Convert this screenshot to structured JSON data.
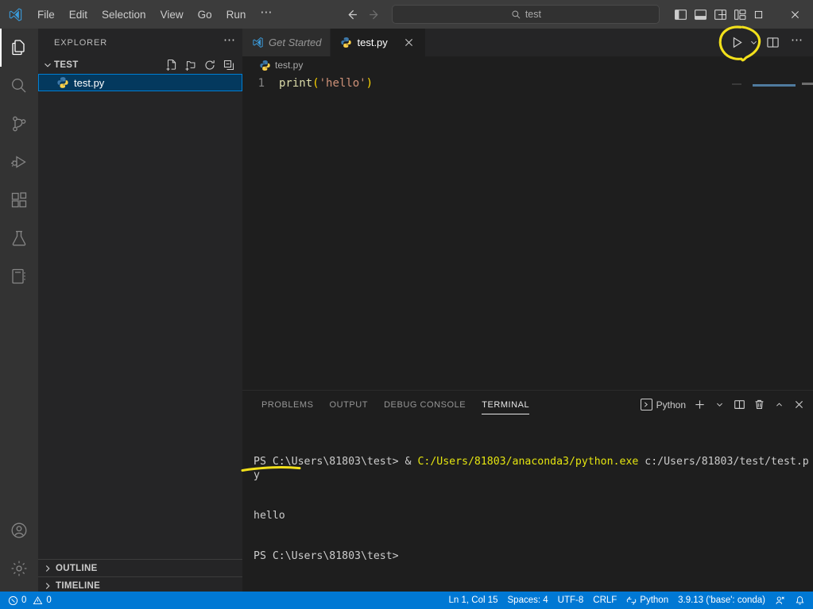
{
  "titlebar": {
    "logo_icon": "vscode-logo",
    "menus": [
      {
        "label": "File"
      },
      {
        "label": "Edit"
      },
      {
        "label": "Selection"
      },
      {
        "label": "View"
      },
      {
        "label": "Go"
      },
      {
        "label": "Run"
      },
      {
        "label": "⋯"
      }
    ],
    "nav": {
      "back_icon": "arrow-left-icon",
      "forward_icon": "arrow-right-icon"
    },
    "command_center": {
      "icon": "search-icon",
      "value": "test",
      "placeholder": "Search"
    },
    "layout_icons": [
      {
        "name": "toggle-primary-sidebar-icon"
      },
      {
        "name": "toggle-panel-icon"
      },
      {
        "name": "toggle-secondary-sidebar-icon"
      },
      {
        "name": "customize-layout-icon"
      }
    ],
    "window_controls": [
      {
        "name": "minimize-button",
        "glyph": "minimize"
      },
      {
        "name": "maximize-button",
        "glyph": "maximize"
      },
      {
        "name": "close-button",
        "glyph": "close"
      }
    ]
  },
  "activitybar": {
    "items": [
      {
        "name": "explorer",
        "icon": "files-icon",
        "active": true
      },
      {
        "name": "search",
        "icon": "search-icon",
        "active": false
      },
      {
        "name": "source-control",
        "icon": "source-control-icon",
        "active": false
      },
      {
        "name": "run-and-debug",
        "icon": "run-debug-icon",
        "active": false
      },
      {
        "name": "extensions",
        "icon": "extensions-icon",
        "active": false
      },
      {
        "name": "testing",
        "icon": "beaker-icon",
        "active": false
      },
      {
        "name": "notebook",
        "icon": "notebook-icon",
        "active": false
      }
    ],
    "bottom": [
      {
        "name": "accounts",
        "icon": "account-icon"
      },
      {
        "name": "manage-settings",
        "icon": "gear-icon"
      }
    ]
  },
  "sidebar": {
    "title": "EXPLORER",
    "more_glyph": "⋯",
    "folder": {
      "label": "TEST",
      "expanded": true,
      "actions": [
        {
          "name": "new-file",
          "icon": "new-file-icon"
        },
        {
          "name": "new-folder",
          "icon": "new-folder-icon"
        },
        {
          "name": "refresh-explorer",
          "icon": "refresh-icon"
        },
        {
          "name": "collapse-folders",
          "icon": "collapse-all-icon"
        }
      ]
    },
    "files": [
      {
        "name": "test.py",
        "icon": "python-file-icon",
        "selected": true
      }
    ],
    "collapsed_sections": [
      {
        "label": "OUTLINE"
      },
      {
        "label": "TIMELINE"
      }
    ]
  },
  "editor": {
    "tabs": [
      {
        "label": "Get Started",
        "icon": "vscode-logo",
        "active": false,
        "italic": true,
        "closable": false
      },
      {
        "label": "test.py",
        "icon": "python-file-icon",
        "active": true,
        "italic": false,
        "closable": true
      }
    ],
    "tab_actions": [
      {
        "name": "run-python-file",
        "icon": "play-icon"
      },
      {
        "name": "run-options-chevron",
        "icon": "chevron-down-icon"
      },
      {
        "name": "split-editor-right",
        "icon": "split-editor-icon"
      },
      {
        "name": "more-actions",
        "icon": "ellipsis-icon",
        "glyph": "⋯"
      }
    ],
    "breadcrumb": {
      "label": "test.py",
      "icon": "python-file-icon"
    },
    "code": {
      "line_number": "1",
      "tokens": [
        {
          "text": "print",
          "type": "function"
        },
        {
          "text": "(",
          "type": "paren"
        },
        {
          "text": "'hello'",
          "type": "string"
        },
        {
          "text": ")",
          "type": "paren"
        }
      ],
      "full_text": "print('hello')"
    }
  },
  "panel": {
    "tabs": [
      {
        "label": "PROBLEMS",
        "active": false
      },
      {
        "label": "OUTPUT",
        "active": false
      },
      {
        "label": "DEBUG CONSOLE",
        "active": false
      },
      {
        "label": "TERMINAL",
        "active": true
      }
    ],
    "terminal_selector": {
      "label": "Python",
      "icon": "terminal-icon"
    },
    "actions": [
      {
        "name": "new-terminal",
        "icon": "plus-icon"
      },
      {
        "name": "terminal-profile-chevron",
        "icon": "chevron-down-icon"
      },
      {
        "name": "split-terminal",
        "icon": "split-icon"
      },
      {
        "name": "kill-terminal",
        "icon": "trash-icon"
      },
      {
        "name": "maximize-panel",
        "icon": "chevron-up-icon"
      },
      {
        "name": "close-panel",
        "icon": "close-icon"
      }
    ],
    "terminal": {
      "line1_prompt": "PS C:\\Users\\81803\\test> & ",
      "line1_path": "C:/Users/81803/anaconda3/python.exe",
      "line1_arg": " c:/Users/81803/test/test.py",
      "line2_output": "hello",
      "line3_prompt": "PS C:\\Users\\81803\\test>"
    }
  },
  "statusbar": {
    "left": [
      {
        "name": "problems",
        "icon": "error-icon",
        "errors": "0",
        "warn_icon": "warning-icon",
        "warnings": "0"
      }
    ],
    "right": [
      {
        "name": "editor-position",
        "label": "Ln 1, Col 15"
      },
      {
        "name": "editor-indentation",
        "label": "Spaces: 4"
      },
      {
        "name": "editor-encoding",
        "label": "UTF-8"
      },
      {
        "name": "editor-eol",
        "label": "CRLF"
      },
      {
        "name": "editor-language",
        "label": "Python",
        "icon": "python-lang-icon"
      },
      {
        "name": "python-interpreter",
        "label": "3.9.13 ('base': conda)"
      },
      {
        "name": "remote-host",
        "icon": "remote-icon"
      },
      {
        "name": "notifications",
        "icon": "bell-icon"
      }
    ]
  },
  "annotations": [
    {
      "name": "run-button-highlight-circle",
      "shape": "ellipse",
      "color": "#f2e01b"
    },
    {
      "name": "hello-output-underline",
      "shape": "line",
      "color": "#f2e01b"
    }
  ],
  "colors": {
    "accent": "#0078d4",
    "annotation": "#f2e01b",
    "selection": "#04395e",
    "selection_border": "#007fd4",
    "editor_bg": "#1e1e1e",
    "sidebar_bg": "#252526",
    "activitybar_bg": "#333333",
    "titlebar_bg": "#3c3c3c"
  }
}
